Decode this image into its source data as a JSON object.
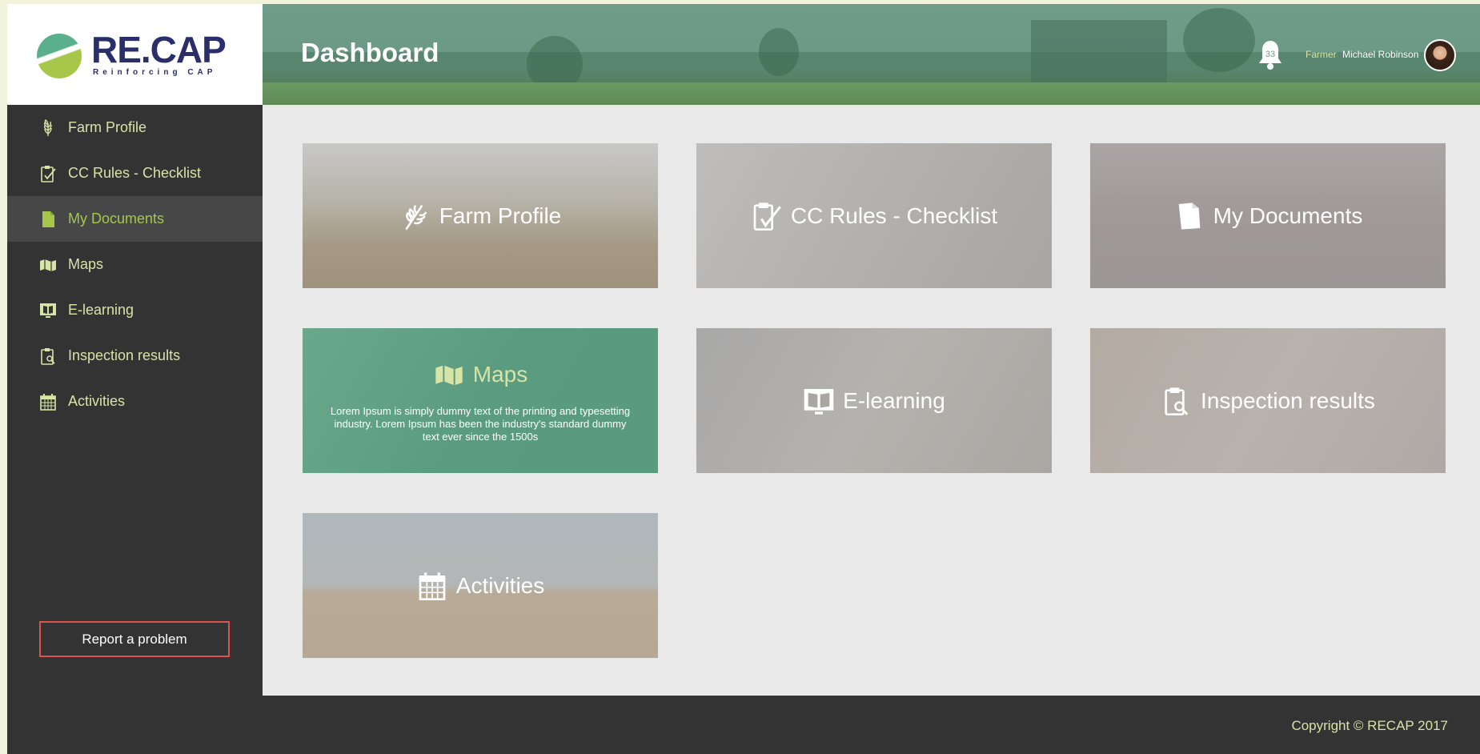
{
  "logo": {
    "brand": "RE.CAP",
    "tagline": "Reinforcing CAP"
  },
  "sidebar": {
    "items": [
      {
        "label": "Farm Profile",
        "icon": "wheat-icon",
        "active": false
      },
      {
        "label": "CC Rules - Checklist",
        "icon": "clipboard-check-icon",
        "active": false
      },
      {
        "label": "My Documents",
        "icon": "document-icon",
        "active": true
      },
      {
        "label": "Maps",
        "icon": "map-icon",
        "active": false
      },
      {
        "label": "E-learning",
        "icon": "book-screen-icon",
        "active": false
      },
      {
        "label": "Inspection results",
        "icon": "clipboard-search-icon",
        "active": false
      },
      {
        "label": "Activities",
        "icon": "calendar-icon",
        "active": false
      }
    ],
    "report_button": "Report a problem"
  },
  "header": {
    "title": "Dashboard",
    "notifications_count": "33",
    "user_role": "Farmer",
    "user_name": "Michael Robinson"
  },
  "tiles": {
    "farm_profile": "Farm Profile",
    "cc_rules": "CC Rules - Checklist",
    "my_documents": "My Documents",
    "maps": "Maps",
    "maps_description": "Lorem Ipsum is simply dummy text of the printing and typesetting industry. Lorem Ipsum has been the industry's standard dummy text ever since the 1500s",
    "e_learning": "E-learning",
    "inspection_results": "Inspection results",
    "activities": "Activities"
  },
  "footer": {
    "copyright": "Copyright © RECAP 2017"
  },
  "colors": {
    "sidebar_bg": "#333333",
    "accent_text": "#d8e3a6",
    "header_green": "#6f9d8a",
    "maps_tile_green": "#5b9c80",
    "report_border": "#d9534f",
    "content_bg": "#e9e9e9"
  }
}
